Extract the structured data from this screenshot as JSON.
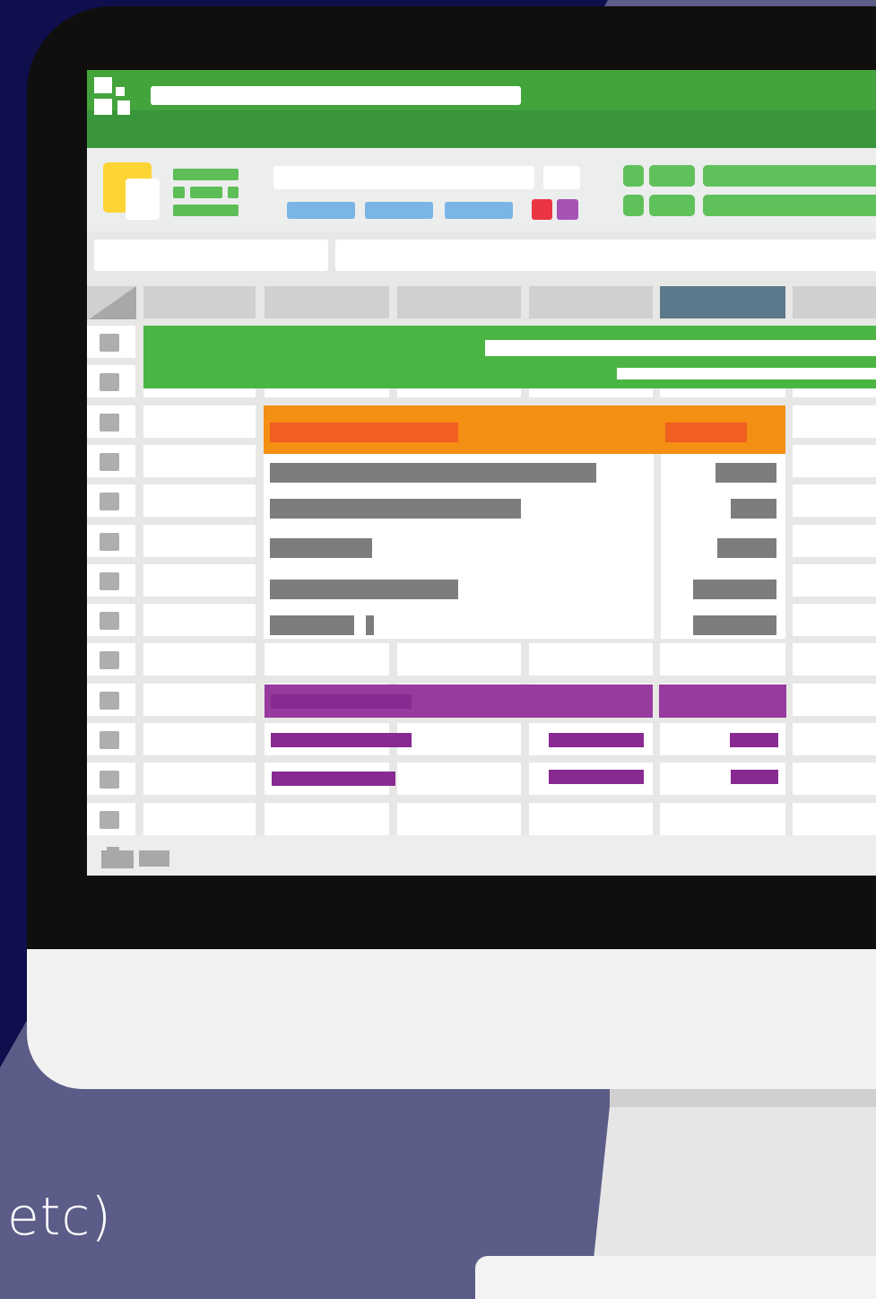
{
  "caption": {
    "text": "etc)"
  },
  "colors": {
    "background_navy": "#0f0f4d",
    "background_purple": "#5b5c87",
    "bezel": "#100f0e",
    "title_bar_green": "#43a43c",
    "ribbon_green": "#3a963a",
    "header_highlight": "#5c798b",
    "banner_green": "#4ab542",
    "orange": "#f38f13",
    "red_orange": "#f05f1f",
    "purple": "#973b9f",
    "dark_purple": "#882a91",
    "gray_text_bar": "#7d7d7f"
  },
  "icons": [
    "app-logo-icon",
    "document-icon",
    "select-all-corner-icon",
    "sheet-tab-icon"
  ]
}
